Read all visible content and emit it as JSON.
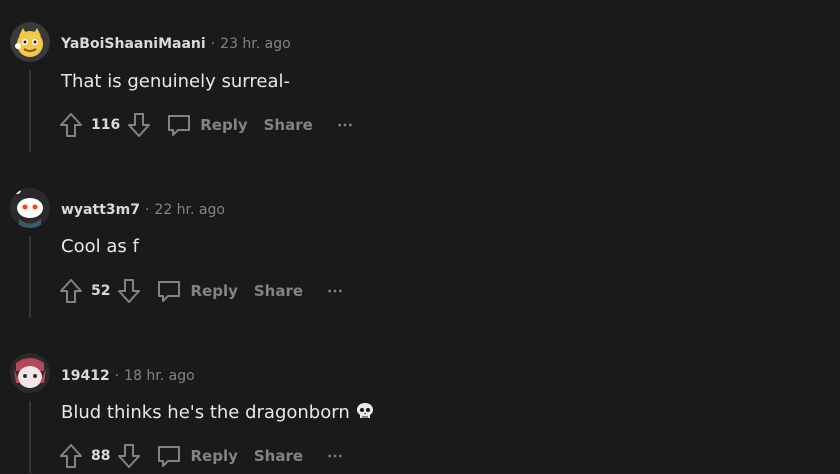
{
  "comments": [
    {
      "username": "YaBoiShaaniMaani",
      "time": "23 hr. ago",
      "text": "That is genuinely surreal-",
      "score": "116",
      "reply_label": "Reply",
      "share_label": "Share"
    },
    {
      "username": "wyatt3m7",
      "time": "22 hr. ago",
      "text": "Cool as f",
      "score": "52",
      "reply_label": "Reply",
      "share_label": "Share"
    },
    {
      "username": "19412",
      "time": "18 hr. ago",
      "text": "Blud thinks he's the dragonborn",
      "score": "88",
      "reply_label": "Reply",
      "share_label": "Share",
      "emoji": "skull-icon"
    }
  ],
  "separator": "·"
}
